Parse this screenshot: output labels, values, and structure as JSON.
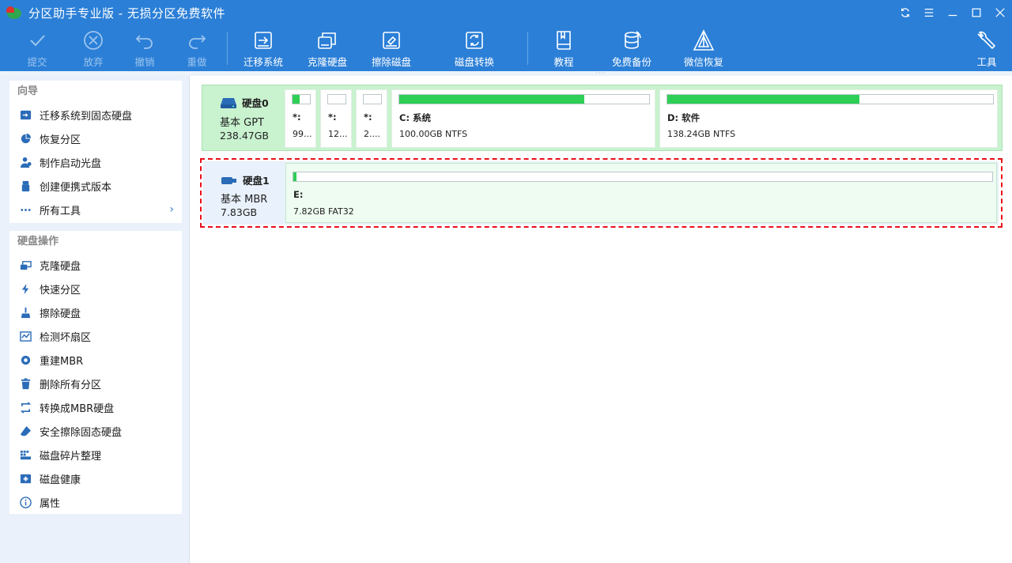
{
  "window": {
    "title": "分区助手专业版 - 无损分区免费软件"
  },
  "toolbar": {
    "commit": "提交",
    "discard": "放弃",
    "undo": "撤销",
    "redo": "重做",
    "migrate_os": "迁移系统",
    "clone_disk": "克隆硬盘",
    "wipe_disk": "擦除磁盘",
    "disk_convert": "磁盘转换",
    "tutorial": "教程",
    "free_backup": "免费备份",
    "wechat_recovery": "微信恢复",
    "tools": "工具"
  },
  "wizard": {
    "title": "向导",
    "items": [
      {
        "label": "迁移系统到固态硬盘",
        "icon": "migrate-icon"
      },
      {
        "label": "恢复分区",
        "icon": "pie-icon"
      },
      {
        "label": "制作启动光盘",
        "icon": "person-icon"
      },
      {
        "label": "创建便携式版本",
        "icon": "usb-icon"
      },
      {
        "label": "所有工具",
        "icon": "dots-icon"
      }
    ]
  },
  "disk_ops": {
    "title": "硬盘操作",
    "items": [
      {
        "label": "克隆硬盘",
        "icon": "clone-icon"
      },
      {
        "label": "快速分区",
        "icon": "lightning-icon"
      },
      {
        "label": "擦除硬盘",
        "icon": "broom-icon"
      },
      {
        "label": "检测坏扇区",
        "icon": "chart-icon"
      },
      {
        "label": "重建MBR",
        "icon": "rebuild-icon"
      },
      {
        "label": "删除所有分区",
        "icon": "trash-icon"
      },
      {
        "label": "转换成MBR硬盘",
        "icon": "convert-icon"
      },
      {
        "label": "安全擦除固态硬盘",
        "icon": "eraser-icon"
      },
      {
        "label": "磁盘碎片整理",
        "icon": "defrag-icon"
      },
      {
        "label": "磁盘健康",
        "icon": "health-icon"
      },
      {
        "label": "属性",
        "icon": "info-icon"
      }
    ]
  },
  "disks": {
    "disk0": {
      "name": "硬盘0",
      "type": "基本 GPT",
      "size": "238.47GB",
      "partitions": [
        {
          "label": "*:",
          "info": "99...",
          "used_fraction": 0.4
        },
        {
          "label": "*:",
          "info": "12...",
          "used_fraction": 0.0
        },
        {
          "label": "*:",
          "info": "2....",
          "used_fraction": 0.0
        },
        {
          "label": "C: 系统",
          "info": "100.00GB NTFS",
          "used_fraction": 0.74
        },
        {
          "label": "D: 软件",
          "info": "138.24GB NTFS",
          "used_fraction": 0.59
        }
      ]
    },
    "disk1": {
      "name": "硬盘1",
      "type": "基本 MBR",
      "size": "7.83GB",
      "partitions": [
        {
          "label": "E:",
          "info": "7.82GB FAT32",
          "used_fraction": 0.004
        }
      ]
    }
  },
  "colors": {
    "titlebar": "#2b7fd7",
    "used_bar": "#2ecf55",
    "selection_border": "#e8101b"
  }
}
